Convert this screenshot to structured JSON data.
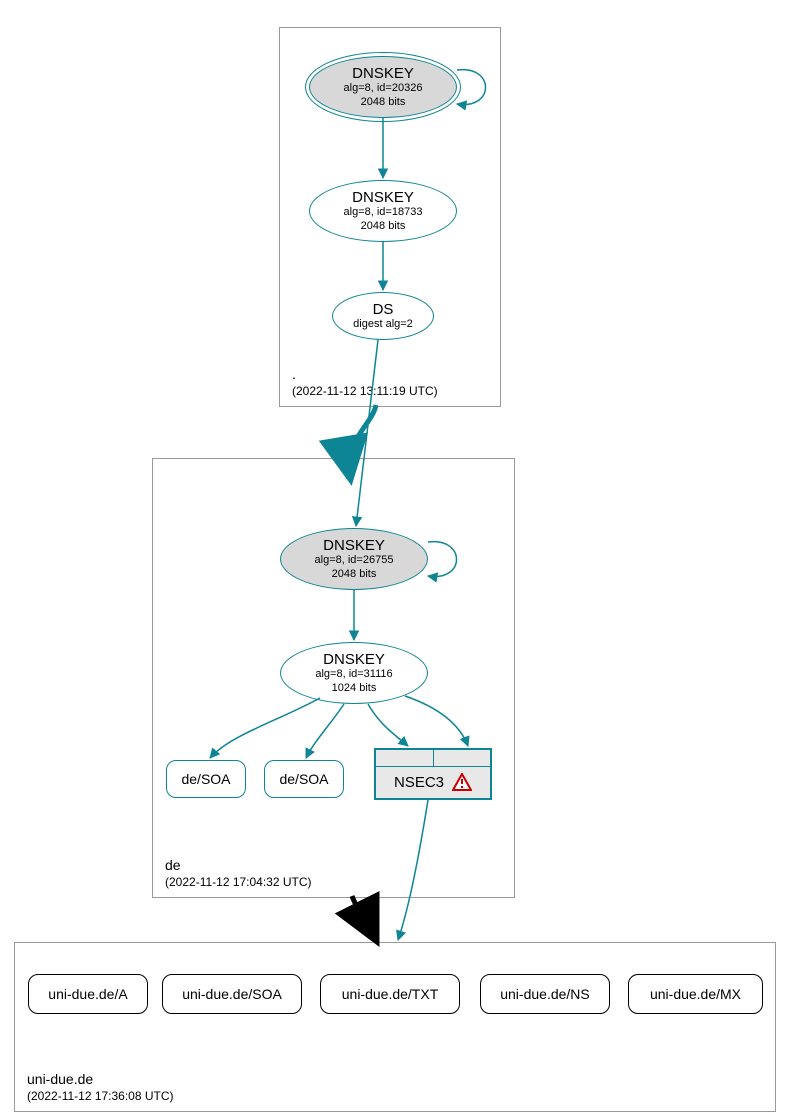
{
  "zones": {
    "root": {
      "name": ".",
      "timestamp": "(2022-11-12 13:11:19 UTC)",
      "ksk": {
        "title": "DNSKEY",
        "line1": "alg=8, id=20326",
        "line2": "2048 bits"
      },
      "zsk": {
        "title": "DNSKEY",
        "line1": "alg=8, id=18733",
        "line2": "2048 bits"
      },
      "ds": {
        "title": "DS",
        "line1": "digest alg=2"
      }
    },
    "de": {
      "name": "de",
      "timestamp": "(2022-11-12 17:04:32 UTC)",
      "ksk": {
        "title": "DNSKEY",
        "line1": "alg=8, id=26755",
        "line2": "2048 bits"
      },
      "zsk": {
        "title": "DNSKEY",
        "line1": "alg=8, id=31116",
        "line2": "1024 bits"
      },
      "soa1": "de/SOA",
      "soa2": "de/SOA",
      "nsec3": "NSEC3"
    },
    "uni": {
      "name": "uni-due.de",
      "timestamp": "(2022-11-12 17:36:08 UTC)",
      "records": {
        "a": "uni-due.de/A",
        "soa": "uni-due.de/SOA",
        "txt": "uni-due.de/TXT",
        "ns": "uni-due.de/NS",
        "mx": "uni-due.de/MX"
      }
    }
  }
}
